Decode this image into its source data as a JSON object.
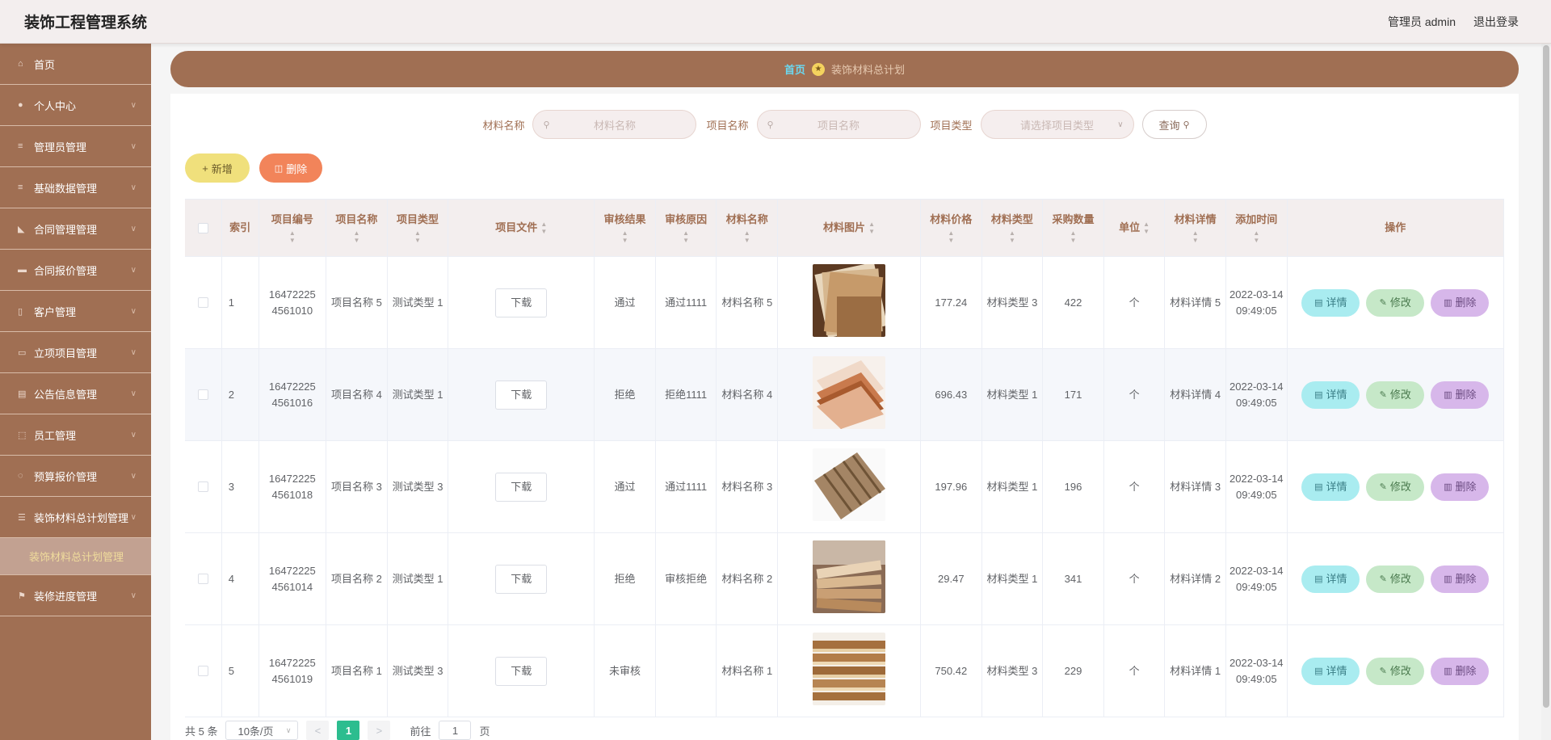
{
  "header": {
    "title": "装饰工程管理系统",
    "user": "管理员 admin",
    "logout": "退出登录"
  },
  "sidebar": {
    "items": [
      {
        "label": "首页",
        "icon": "home-icon",
        "chev": false
      },
      {
        "label": "个人中心",
        "icon": "user-icon",
        "chev": true
      },
      {
        "label": "管理员管理",
        "icon": "list-icon",
        "chev": true
      },
      {
        "label": "基础数据管理",
        "icon": "list-icon",
        "chev": true
      },
      {
        "label": "合同管理管理",
        "icon": "thumb-icon",
        "chev": true
      },
      {
        "label": "合同报价管理",
        "icon": "ticket-icon",
        "chev": true
      },
      {
        "label": "客户管理",
        "icon": "phone-icon",
        "chev": true
      },
      {
        "label": "立项项目管理",
        "icon": "monitor-icon",
        "chev": true
      },
      {
        "label": "公告信息管理",
        "icon": "note-icon",
        "chev": true
      },
      {
        "label": "员工管理",
        "icon": "frame-icon",
        "chev": true
      },
      {
        "label": "预算报价管理",
        "icon": "loading-icon",
        "chev": true
      },
      {
        "label": "装饰材料总计划管理",
        "icon": "sliders-icon",
        "chev": true
      }
    ],
    "sub_item": "装饰材料总计划管理",
    "last_item": {
      "label": "装修进度管理",
      "icon": "flag-icon"
    }
  },
  "breadcrumb": {
    "home": "首页",
    "current": "装饰材料总计划"
  },
  "search": {
    "material_label": "材料名称",
    "material_placeholder": "材料名称",
    "project_label": "项目名称",
    "project_placeholder": "项目名称",
    "type_label": "项目类型",
    "type_placeholder": "请选择项目类型",
    "query": "查询"
  },
  "toolbar": {
    "add": "新增",
    "delete": "删除"
  },
  "table": {
    "headers": [
      "索引",
      "项目编号",
      "项目名称",
      "项目类型",
      "项目文件",
      "审核结果",
      "审核原因",
      "材料名称",
      "材料图片",
      "材料价格",
      "材料类型",
      "采购数量",
      "单位",
      "材料详情",
      "添加时间",
      "操作"
    ],
    "download": "下载",
    "detail": "详情",
    "edit": "修改",
    "remove": "删除",
    "rows": [
      {
        "idx": "1",
        "code": "16472225 4561010",
        "name": "项目名称 5",
        "ptype": "测试类型 1",
        "result": "通过",
        "reason": "通过1111",
        "mname": "材料名称 5",
        "price": "177.24",
        "mtype": "材料类型 3",
        "qty": "422",
        "unit": "个",
        "detail": "材料详情 5",
        "time": "2022-03-14 09:49:05",
        "img": "planks-light"
      },
      {
        "idx": "2",
        "code": "16472225 4561016",
        "name": "项目名称 4",
        "ptype": "测试类型 1",
        "result": "拒绝",
        "reason": "拒绝1111",
        "mname": "材料名称 4",
        "price": "696.43",
        "mtype": "材料类型 1",
        "qty": "171",
        "unit": "个",
        "detail": "材料详情 4",
        "time": "2022-03-14 09:49:05",
        "img": "boards-orange"
      },
      {
        "idx": "3",
        "code": "16472225 4561018",
        "name": "项目名称 3",
        "ptype": "测试类型 3",
        "result": "通过",
        "reason": "通过1111",
        "mname": "材料名称 3",
        "price": "197.96",
        "mtype": "材料类型 1",
        "qty": "196",
        "unit": "个",
        "detail": "材料详情 3",
        "time": "2022-03-14 09:49:05",
        "img": "slats-brown"
      },
      {
        "idx": "4",
        "code": "16472225 4561014",
        "name": "项目名称 2",
        "ptype": "测试类型 1",
        "result": "拒绝",
        "reason": "审核拒绝",
        "mname": "材料名称 2",
        "price": "29.47",
        "mtype": "材料类型 1",
        "qty": "341",
        "unit": "个",
        "detail": "材料详情 2",
        "time": "2022-03-14 09:49:05",
        "img": "lumber-pile"
      },
      {
        "idx": "5",
        "code": "16472225 4561019",
        "name": "项目名称 1",
        "ptype": "测试类型 3",
        "result": "未审核",
        "reason": "",
        "mname": "材料名称 1",
        "price": "750.42",
        "mtype": "材料类型 3",
        "qty": "229",
        "unit": "个",
        "detail": "材料详情 1",
        "time": "2022-03-14 09:49:05",
        "img": "plywood-stack"
      }
    ]
  },
  "pagination": {
    "total": "共 5 条",
    "page_size": "10条/页",
    "prev": "<",
    "current": "1",
    "next": ">",
    "goto": "前往",
    "goto_value": "1",
    "page_unit": "页"
  },
  "colors": {
    "sidebar": "#a06f53",
    "accent_green": "#2cbd8f",
    "header_bg": "#f3eeee"
  }
}
